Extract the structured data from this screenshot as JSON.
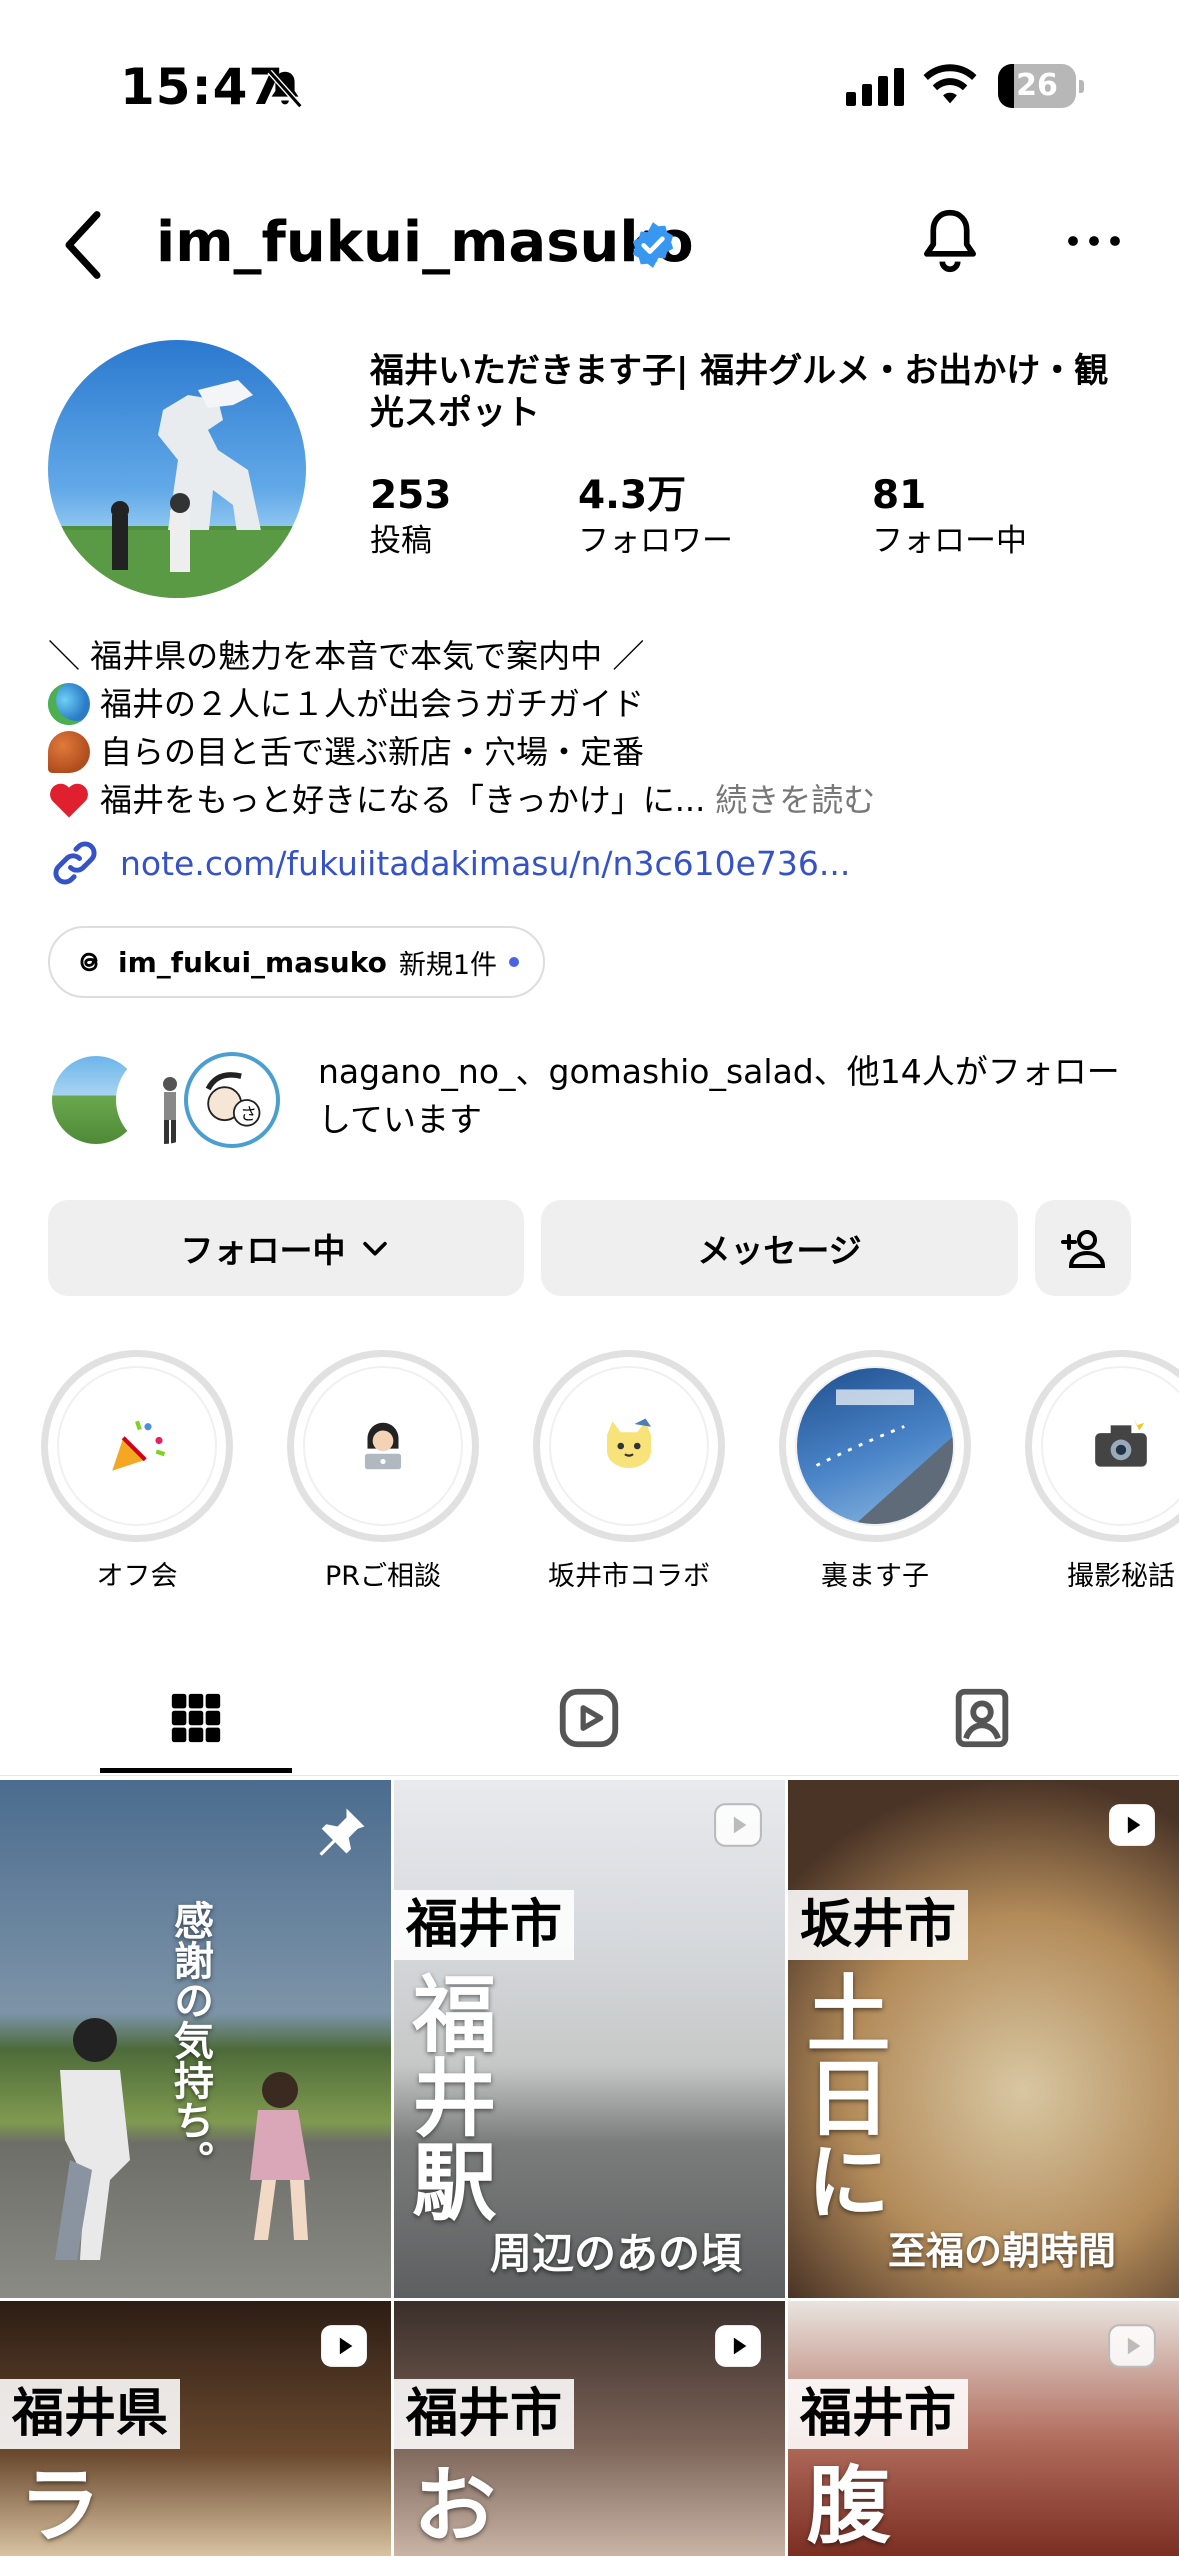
{
  "status_bar": {
    "time": "15:47",
    "battery": "26"
  },
  "header": {
    "username": "im_fukui_masuko"
  },
  "profile": {
    "name": "福井いただきます子| 福井グルメ・お出かけ・観光スポット",
    "stats": [
      {
        "value": "253",
        "label": "投稿"
      },
      {
        "value": "4.3万",
        "label": "フォロワー"
      },
      {
        "value": "81",
        "label": "フォロー中"
      }
    ],
    "bio": {
      "line1": "＼ 福井県の魅力を本音で本気で案内中 ／",
      "line2": "福井の２人に１人が出会うガチガイド",
      "line3": "自らの目と舌で選ぶ新店・穴場・定番",
      "line4": "福井をもっと好きになる「きっかけ」に...",
      "more": "続きを読む"
    },
    "link": "note.com/fukuiitadakimasu/n/n3c610e736...",
    "threads_chip": {
      "handle": "im_fukui_masuko",
      "count": "新規1件"
    },
    "followed_by": "nagano_no_、gomashio_salad、他14人がフォローしています"
  },
  "actions": {
    "following": "フォロー中",
    "message": "メッセージ"
  },
  "highlights": [
    {
      "label": "オフ会",
      "icon": "party-popper-icon"
    },
    {
      "label": "PRご相談",
      "icon": "woman-laptop-icon"
    },
    {
      "label": "坂井市コラボ",
      "icon": "cat-mascot-icon"
    },
    {
      "label": "裏ます子",
      "icon": "airplane-window-icon"
    },
    {
      "label": "撮影秘話",
      "icon": "camera-flash-icon"
    }
  ],
  "tabs": [
    {
      "name": "grid-icon",
      "active": true
    },
    {
      "name": "reels-icon",
      "active": false
    },
    {
      "name": "tagged-icon",
      "active": false
    }
  ],
  "posts": [
    {
      "title": "",
      "big": "感謝の気持ち。",
      "sub": "",
      "type": "pinned"
    },
    {
      "title": "福井市",
      "big": "福井駅",
      "sub": "周辺のあの頃",
      "type": "reel"
    },
    {
      "title": "坂井市",
      "big": "土日に",
      "sub": "至福の朝時間",
      "type": "reel"
    },
    {
      "title": "福井県",
      "big": "ラ",
      "sub": "",
      "type": "reel"
    },
    {
      "title": "福井市",
      "big": "お",
      "sub": "",
      "type": "reel"
    },
    {
      "title": "福井市",
      "big": "腹",
      "sub": "",
      "type": "reel"
    }
  ],
  "colors": {
    "link": "#3552c7",
    "verified": "#3897f0",
    "button_bg": "#efefef"
  }
}
